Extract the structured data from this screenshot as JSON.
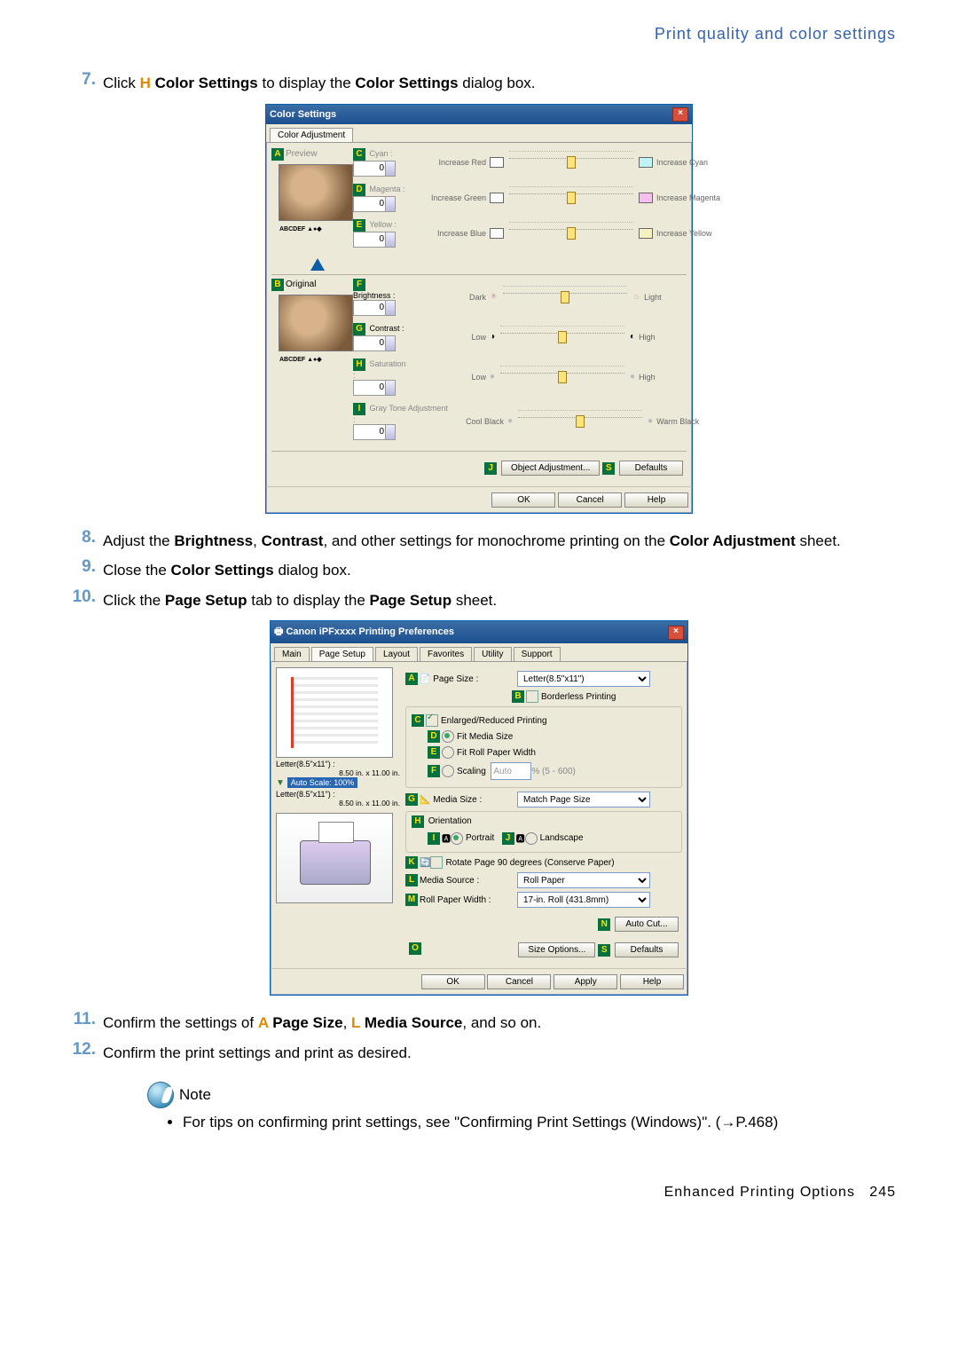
{
  "header": {
    "title": "Print quality and color settings"
  },
  "steps": {
    "s7": {
      "num": "7.",
      "pre": "Click ",
      "marker": "H",
      "link": " Color Settings",
      "mid": " to display the ",
      "link2": "Color Settings",
      "post": " dialog box."
    },
    "s8": {
      "num": "8.",
      "pre": "Adjust the ",
      "b1": "Brightness",
      "mid1": ", ",
      "b2": "Contrast",
      "mid2": ", and other settings for monochrome printing on the ",
      "b3": "Color Adjustment",
      "post": " sheet."
    },
    "s9": {
      "num": "9.",
      "pre": "Close the ",
      "b": "Color Settings",
      "post": " dialog box."
    },
    "s10": {
      "num": "10.",
      "pre": "Click the ",
      "b": "Page Setup",
      "mid": " tab to display the ",
      "b2": "Page Setup",
      "post": " sheet."
    },
    "s11": {
      "num": "11.",
      "pre": "Confirm the settings of ",
      "mA": "A",
      "bA": " Page Size",
      "sep": ", ",
      "mL": "L",
      "bL": " Media Source",
      "post": ", and so on."
    },
    "s12": {
      "num": "12.",
      "txt": "Confirm the print settings and print as desired."
    }
  },
  "cs_dlg": {
    "title": "Color Settings",
    "tab": "Color Adjustment",
    "previewLbl": "Preview",
    "originalLbl": "Original",
    "thumbtxt": "ABCDEF",
    "cyan": "Cyan :",
    "magenta": "Magenta :",
    "yellow": "Yellow :",
    "brightness": "Brightness :",
    "contrast": "Contrast :",
    "saturation": "Saturation :",
    "gray": "Gray Tone Adjustment :",
    "zero": "0",
    "incRed": "Increase Red",
    "incCyan": "Increase Cyan",
    "incGreen": "Increase Green",
    "incMag": "Increase Magenta",
    "incBlue": "Increase Blue",
    "incYel": "Increase Yellow",
    "dark": "Dark",
    "light": "Light",
    "low": "Low",
    "high": "High",
    "coolblk": "Cool Black",
    "warmblk": "Warm Black",
    "objadj": "Object Adjustment...",
    "defaults": "Defaults",
    "ok": "OK",
    "cancel": "Cancel",
    "help": "Help",
    "mA": "A",
    "mB": "B",
    "mC": "C",
    "mD": "D",
    "mE": "E",
    "mF": "F",
    "mG": "G",
    "mH": "H",
    "mI": "I",
    "mJ": "J",
    "mS": "S"
  },
  "ps_dlg": {
    "title": "Canon iPFxxxx Printing Preferences",
    "tabs": {
      "main": "Main",
      "page": "Page Setup",
      "layout": "Layout",
      "fav": "Favorites",
      "util": "Utility",
      "sup": "Support"
    },
    "dim1": "Letter(8.5\"x11\") :",
    "dim1b": "8.50 in. x 11.00 in.",
    "scale": "Auto Scale: 100%",
    "dim2": "Letter(8.5\"x11\") :",
    "dim2b": "8.50 in. x 11.00 in.",
    "pagesize": "Page Size :",
    "pagesize_val": "Letter(8.5\"x11\")",
    "borderless": "Borderless Printing",
    "enlred": "Enlarged/Reduced Printing",
    "fitmedia": "Fit Media Size",
    "fitroll": "Fit Roll Paper Width",
    "scaling": "Scaling",
    "scaling_val": "Auto",
    "scaling_range": "% (5 - 600)",
    "mediasize": "Media Size :",
    "mediasize_val": "Match Page Size",
    "orient": "Orientation",
    "portrait": "Portrait",
    "landscape": "Landscape",
    "rotate": "Rotate Page 90 degrees (Conserve Paper)",
    "mediasrc": "Media Source :",
    "mediasrc_val": "Roll Paper",
    "rollwidth": "Roll Paper Width :",
    "rollwidth_val": "17-in. Roll (431.8mm)",
    "autocut": "Auto Cut...",
    "sizeopt": "Size Options...",
    "defaults": "Defaults",
    "ok": "OK",
    "cancel": "Cancel",
    "apply": "Apply",
    "help": "Help",
    "mA": "A",
    "mB": "B",
    "mC": "C",
    "mD": "D",
    "mE": "E",
    "mF": "F",
    "mG": "G",
    "mH": "H",
    "mI": "I",
    "mJ": "J",
    "mK": "K",
    "mL": "L",
    "mM": "M",
    "mN": "N",
    "mO": "O",
    "mS": "S"
  },
  "note": {
    "label": "Note",
    "bullet": "For tips on confirming print settings, see \"Confirming Print Settings (Windows)\".  (→P.468)"
  },
  "footer": {
    "section": "Enhanced Printing Options",
    "page": "245"
  }
}
